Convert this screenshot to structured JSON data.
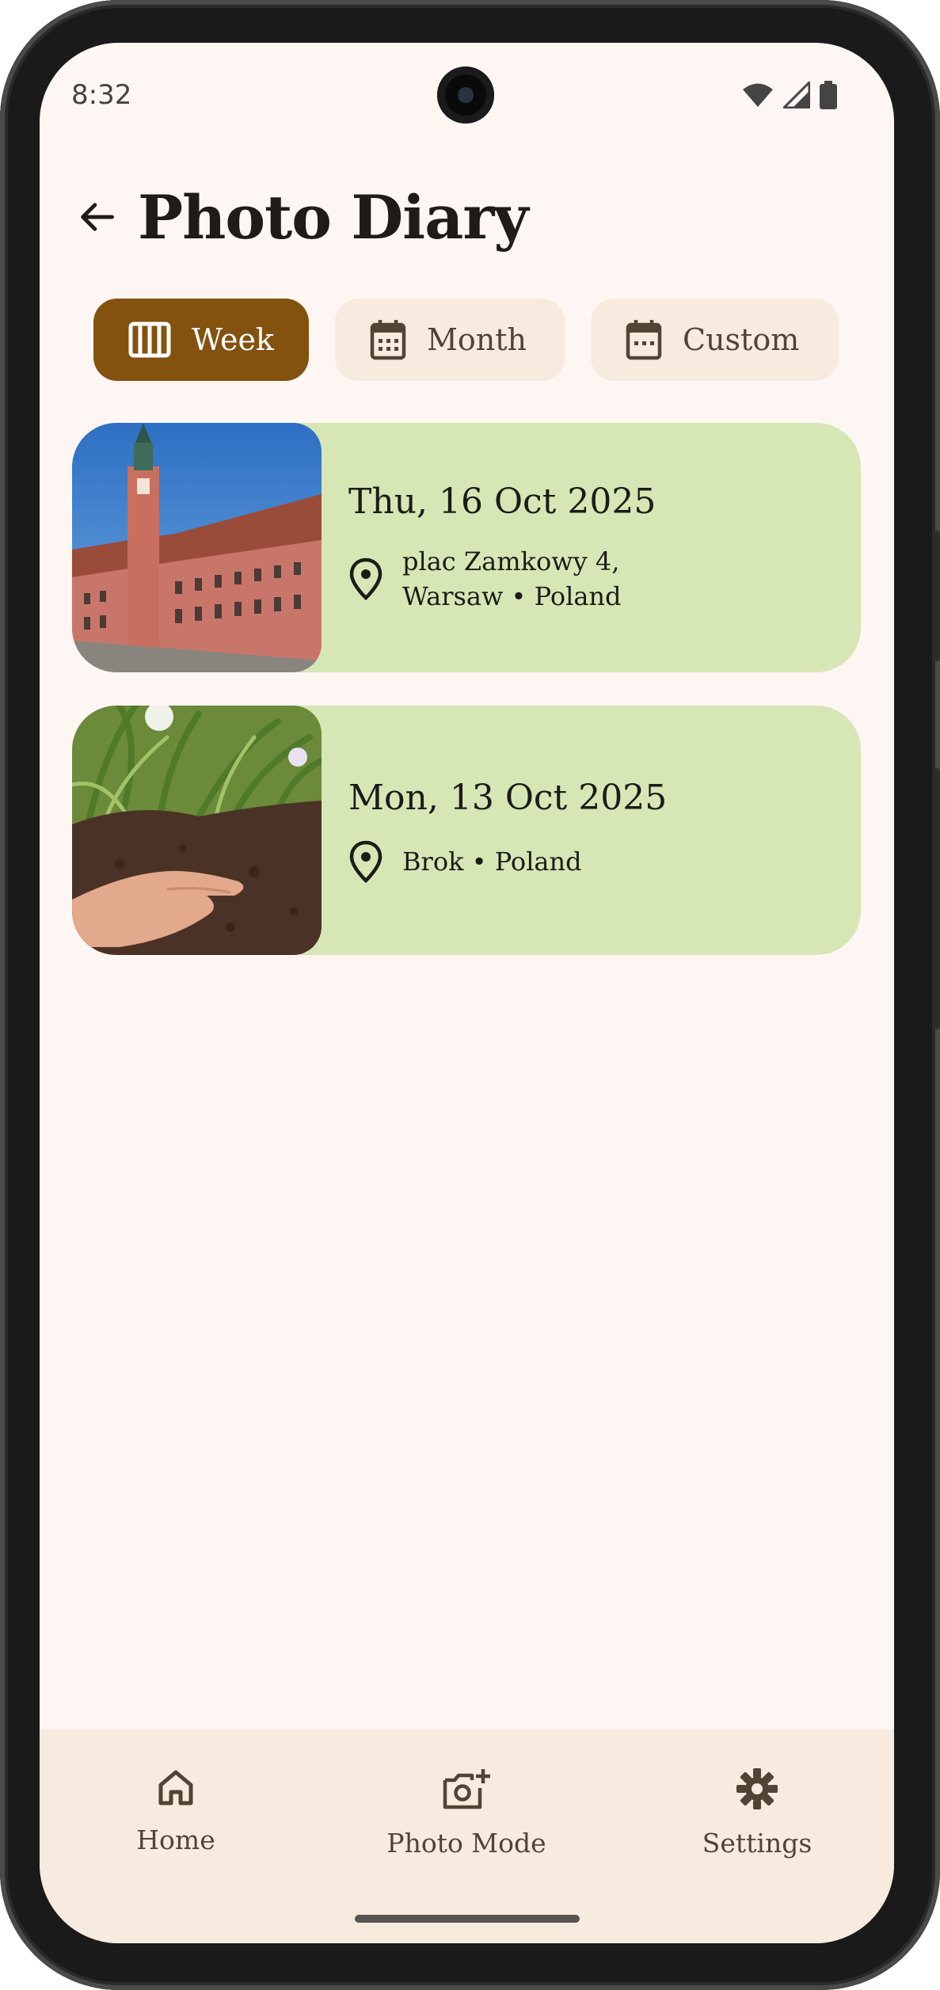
{
  "status_bar": {
    "time": "8:32"
  },
  "header": {
    "title": "Photo Diary"
  },
  "filters": [
    {
      "label": "Week",
      "selected": true,
      "icon": "view-week-icon"
    },
    {
      "label": "Month",
      "selected": false,
      "icon": "calendar-month-icon"
    },
    {
      "label": "Custom",
      "selected": false,
      "icon": "calendar-custom-icon"
    }
  ],
  "entries": [
    {
      "date": "Thu, 16 Oct 2025",
      "location_line1": "plac Zamkowy 4,",
      "location_line2": "Warsaw • Poland",
      "thumbnail": "castle-photo"
    },
    {
      "date": "Mon, 13 Oct 2025",
      "location_line1": "Brok • Poland",
      "location_line2": "",
      "thumbnail": "soil-hand-photo"
    }
  ],
  "bottom_nav": [
    {
      "label": "Home",
      "icon": "home-icon"
    },
    {
      "label": "Photo Mode",
      "icon": "add-photo-icon"
    },
    {
      "label": "Settings",
      "icon": "gear-icon"
    }
  ],
  "colors": {
    "background": "#fdf6f3",
    "accent": "#83520f",
    "chip_unselected": "#f7eadf",
    "card": "#d7e6b5",
    "nav_bar": "#f7eadf"
  }
}
